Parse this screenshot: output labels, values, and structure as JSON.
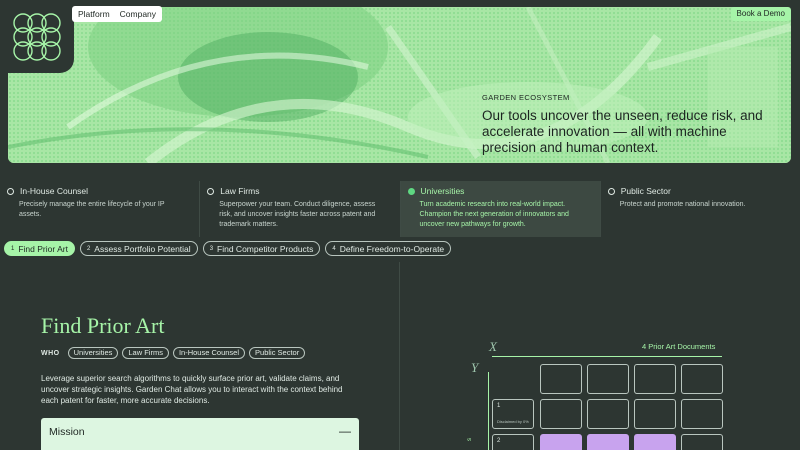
{
  "nav": {
    "items": [
      "Platform",
      "Company"
    ],
    "demo_label": "Book a Demo"
  },
  "hero": {
    "eyebrow": "GARDEN ECOSYSTEM",
    "title": "Our tools uncover the unseen, reduce risk, and accelerate innovation — all with machine precision and human context."
  },
  "audiences": [
    {
      "name": "In-House Counsel",
      "desc": "Precisely manage the entire lifecycle of your IP assets.",
      "active": false
    },
    {
      "name": "Law Firms",
      "desc": "Superpower your team. Conduct diligence, assess risk, and uncover insights faster across patent and trademark matters.",
      "active": false
    },
    {
      "name": "Universities",
      "desc": "Turn academic research into real-world impact. Champion the next generation of innovators and uncover new pathways for growth.",
      "active": true
    },
    {
      "name": "Public Sector",
      "desc": "Protect and promote national innovation.",
      "active": false
    }
  ],
  "tabs": [
    {
      "num": "1",
      "label": "Find Prior Art",
      "active": true
    },
    {
      "num": "2",
      "label": "Assess Portfolio Potential",
      "active": false
    },
    {
      "num": "3",
      "label": "Find Competitor Products",
      "active": false
    },
    {
      "num": "4",
      "label": "Define Freedom-to-Operate",
      "active": false
    }
  ],
  "section": {
    "title": "Find Prior Art",
    "who_label": "WHO",
    "who_chips": [
      "Universities",
      "Law Firms",
      "In-House Counsel",
      "Public Sector"
    ],
    "desc": "Leverage superior search algorithms to quickly surface prior art, validate claims, and uncover strategic insights. Garden Chat allows you to interact with the context behind each patent for faster, more accurate decisions.",
    "mission_label": "Mission",
    "mission_toggle": "—"
  },
  "grid": {
    "x_label": "X",
    "y_label": "Y",
    "count_label": "4 Prior Art Documents",
    "row1_num": "1",
    "row1_sub": "Disclaimed by 0%",
    "row2_num": "2",
    "side_label": "s"
  },
  "colors": {
    "accent": "#a6f4a8",
    "background": "#2d3632",
    "highlight": "#c8a3ee"
  }
}
